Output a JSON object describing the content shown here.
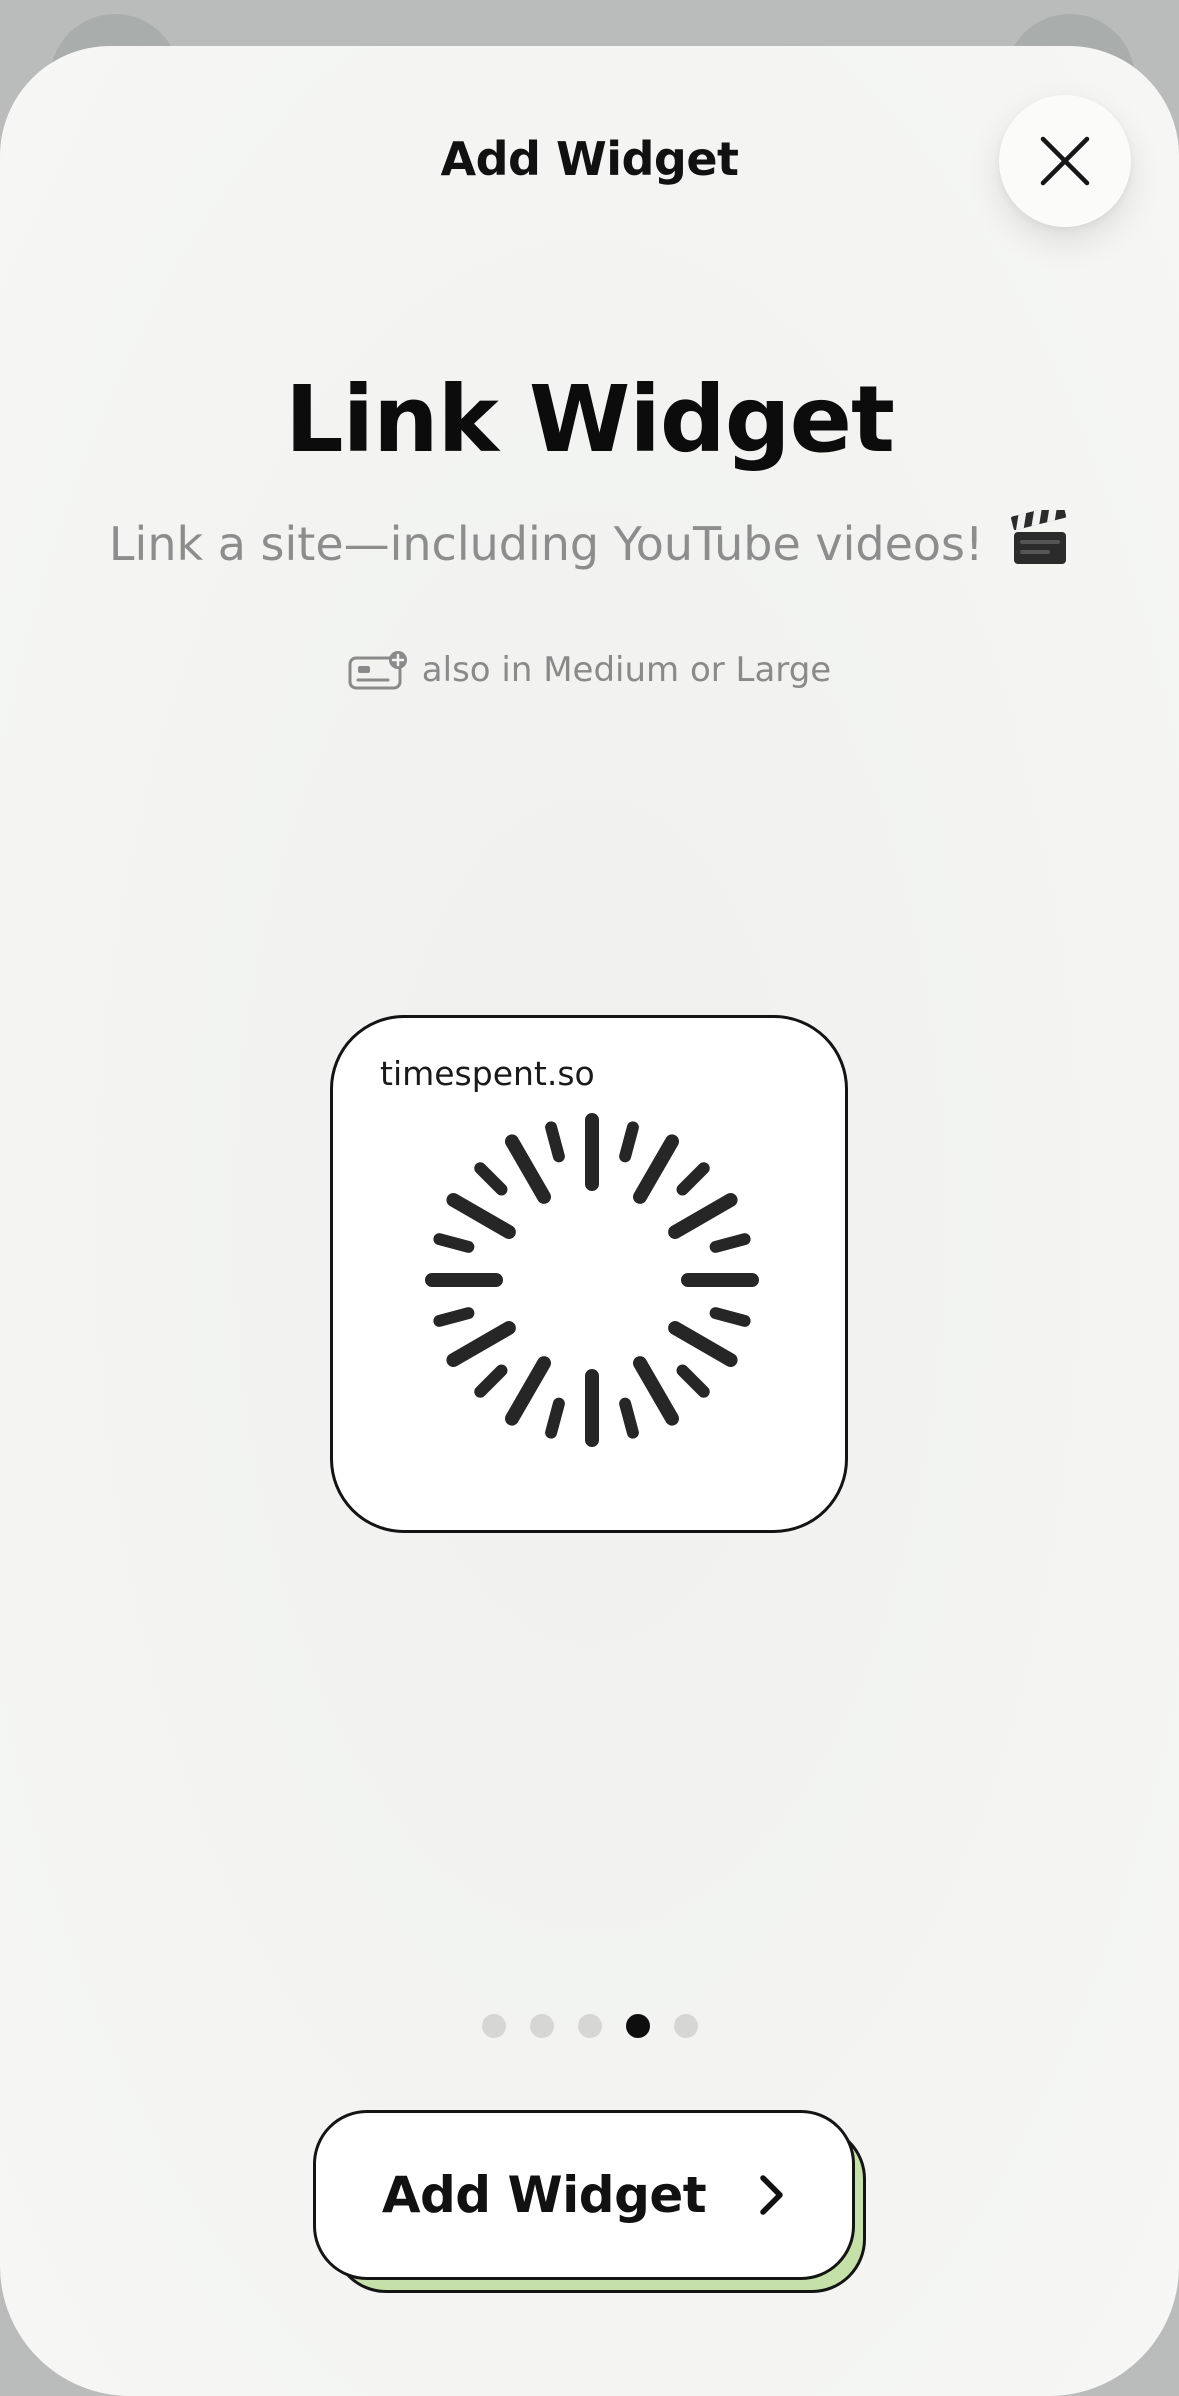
{
  "sheet": {
    "title": "Add Widget",
    "close_icon": "close-icon"
  },
  "widget": {
    "name": "Link Widget",
    "description": "Link a site—including YouTube videos!",
    "description_emoji_icon": "clapperboard-icon",
    "sizes_icon": "widget-size-add-icon",
    "sizes_text": "also in Medium or Large",
    "preview": {
      "domain": "timespent.so",
      "content_icon": "loading-spinner-icon"
    }
  },
  "pagination": {
    "total": 5,
    "current": 4
  },
  "primary_button": {
    "label": "Add Widget",
    "icon": "chevron-right-icon",
    "shadow_color": "#c5e0a8"
  },
  "colors": {
    "background": "#f3f4f2",
    "text_primary": "#111111",
    "text_secondary": "#8d8d8d",
    "dot_inactive": "#d6d7d5",
    "dot_active": "#0e0e0e"
  }
}
